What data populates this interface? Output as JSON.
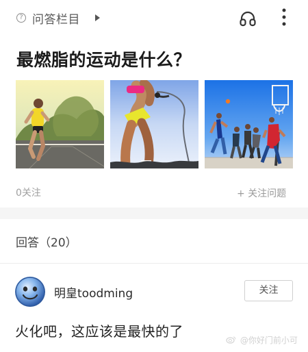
{
  "header": {
    "question_icon_glyph": "?",
    "column_label": "问答栏目",
    "icons": [
      "question-circle-icon",
      "play-icon",
      "headphones-icon",
      "more-vertical-icon"
    ]
  },
  "question": {
    "title": "最燃脂的运动是什么？",
    "followers": "0关注",
    "follow_question": "+ 关注问题"
  },
  "answers": {
    "header": "回答（20）",
    "items": [
      {
        "username": "明皇toodming",
        "follow_label": "关注",
        "text": "火化吧，这应该是最快的了"
      }
    ]
  },
  "watermark": {
    "text": "@你好门前小可"
  }
}
